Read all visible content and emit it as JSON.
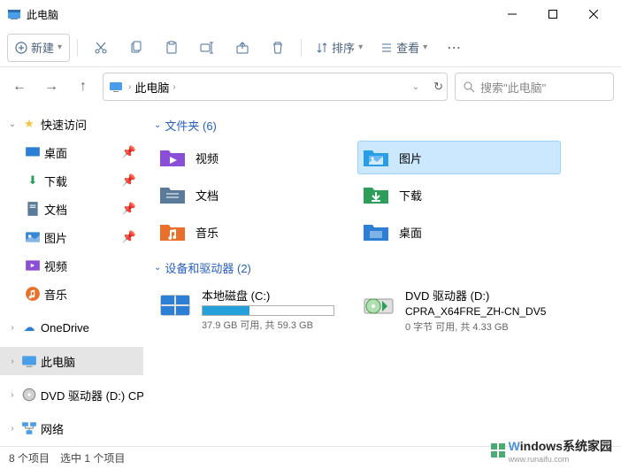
{
  "titlebar": {
    "title": "此电脑"
  },
  "toolbar": {
    "new_label": "新建",
    "sort_label": "排序",
    "view_label": "查看"
  },
  "breadcrumb": {
    "location": "此电脑"
  },
  "search": {
    "placeholder": "搜索\"此电脑\""
  },
  "sidebar": {
    "quick_access": "快速访问",
    "items": [
      {
        "label": "桌面",
        "pin": true
      },
      {
        "label": "下载",
        "pin": true
      },
      {
        "label": "文档",
        "pin": true
      },
      {
        "label": "图片",
        "pin": true
      },
      {
        "label": "视频",
        "pin": false
      },
      {
        "label": "音乐",
        "pin": false
      }
    ],
    "onedrive": "OneDrive",
    "thispc": "此电脑",
    "dvd": "DVD 驱动器 (D:) CP",
    "network": "网络"
  },
  "sections": {
    "folders": {
      "title": "文件夹 (6)"
    },
    "devices": {
      "title": "设备和驱动器 (2)"
    }
  },
  "folders": [
    {
      "label": "视频"
    },
    {
      "label": "图片",
      "selected": true
    },
    {
      "label": "文档"
    },
    {
      "label": "下载"
    },
    {
      "label": "音乐"
    },
    {
      "label": "桌面"
    }
  ],
  "drives": [
    {
      "name": "本地磁盘 (C:)",
      "bar_pct": 36,
      "sub": "37.9 GB 可用, 共 59.3 GB",
      "type": "disk"
    },
    {
      "name": "DVD 驱动器 (D:)",
      "line2": "CPRA_X64FRE_ZH-CN_DV5",
      "sub": "0 字节 可用, 共 4.33 GB",
      "type": "dvd"
    }
  ],
  "statusbar": {
    "count": "8 个项目",
    "selected": "选中 1 个项目"
  },
  "watermark": {
    "top": "indows系统家园",
    "sub": "www.runaifu.com"
  }
}
